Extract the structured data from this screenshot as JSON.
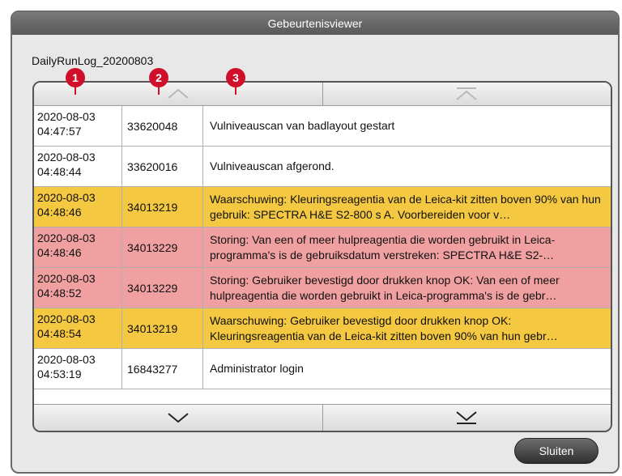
{
  "window": {
    "title": "Gebeurtenisviewer"
  },
  "log_name": "DailyRunLog_20200803",
  "colors": {
    "warning": "#f5c842",
    "error": "#f0a0a0",
    "callout": "#d0102a"
  },
  "callouts": [
    "1",
    "2",
    "3"
  ],
  "events": [
    {
      "date": "2020-08-03",
      "time": "04:47:57",
      "id": "33620048",
      "message": "Vulniveauscan van badlayout gestart",
      "severity": "info"
    },
    {
      "date": "2020-08-03",
      "time": "04:48:44",
      "id": "33620016",
      "message": "Vulniveauscan afgerond.",
      "severity": "info"
    },
    {
      "date": "2020-08-03",
      "time": "04:48:46",
      "id": "34013219",
      "message": "Waarschuwing: Kleuringsreagentia van de Leica-kit zitten boven 90% van hun gebruik: SPECTRA H&E S2-800 s A. Voorbereiden voor v…",
      "severity": "warning"
    },
    {
      "date": "2020-08-03",
      "time": "04:48:46",
      "id": "34013229",
      "message": "Storing: Van een of meer hulpreagentia die worden gebruikt in Leica-programma's is de gebruiksdatum verstreken: SPECTRA H&E S2-…",
      "severity": "error"
    },
    {
      "date": "2020-08-03",
      "time": "04:48:52",
      "id": "34013229",
      "message": "Storing: Gebruiker bevestigd door drukken knop OK: Van een of meer hulpreagentia die worden gebruikt in Leica-programma's is de gebr…",
      "severity": "error"
    },
    {
      "date": "2020-08-03",
      "time": "04:48:54",
      "id": "34013219",
      "message": "Waarschuwing: Gebruiker bevestigd door drukken knop OK: Kleuringsreagentia van de Leica-kit zitten boven 90% van hun gebr…",
      "severity": "warning"
    },
    {
      "date": "2020-08-03",
      "time": "04:53:19",
      "id": "16843277",
      "message": "Administrator login",
      "severity": "info"
    }
  ],
  "buttons": {
    "close": "Sluiten"
  }
}
